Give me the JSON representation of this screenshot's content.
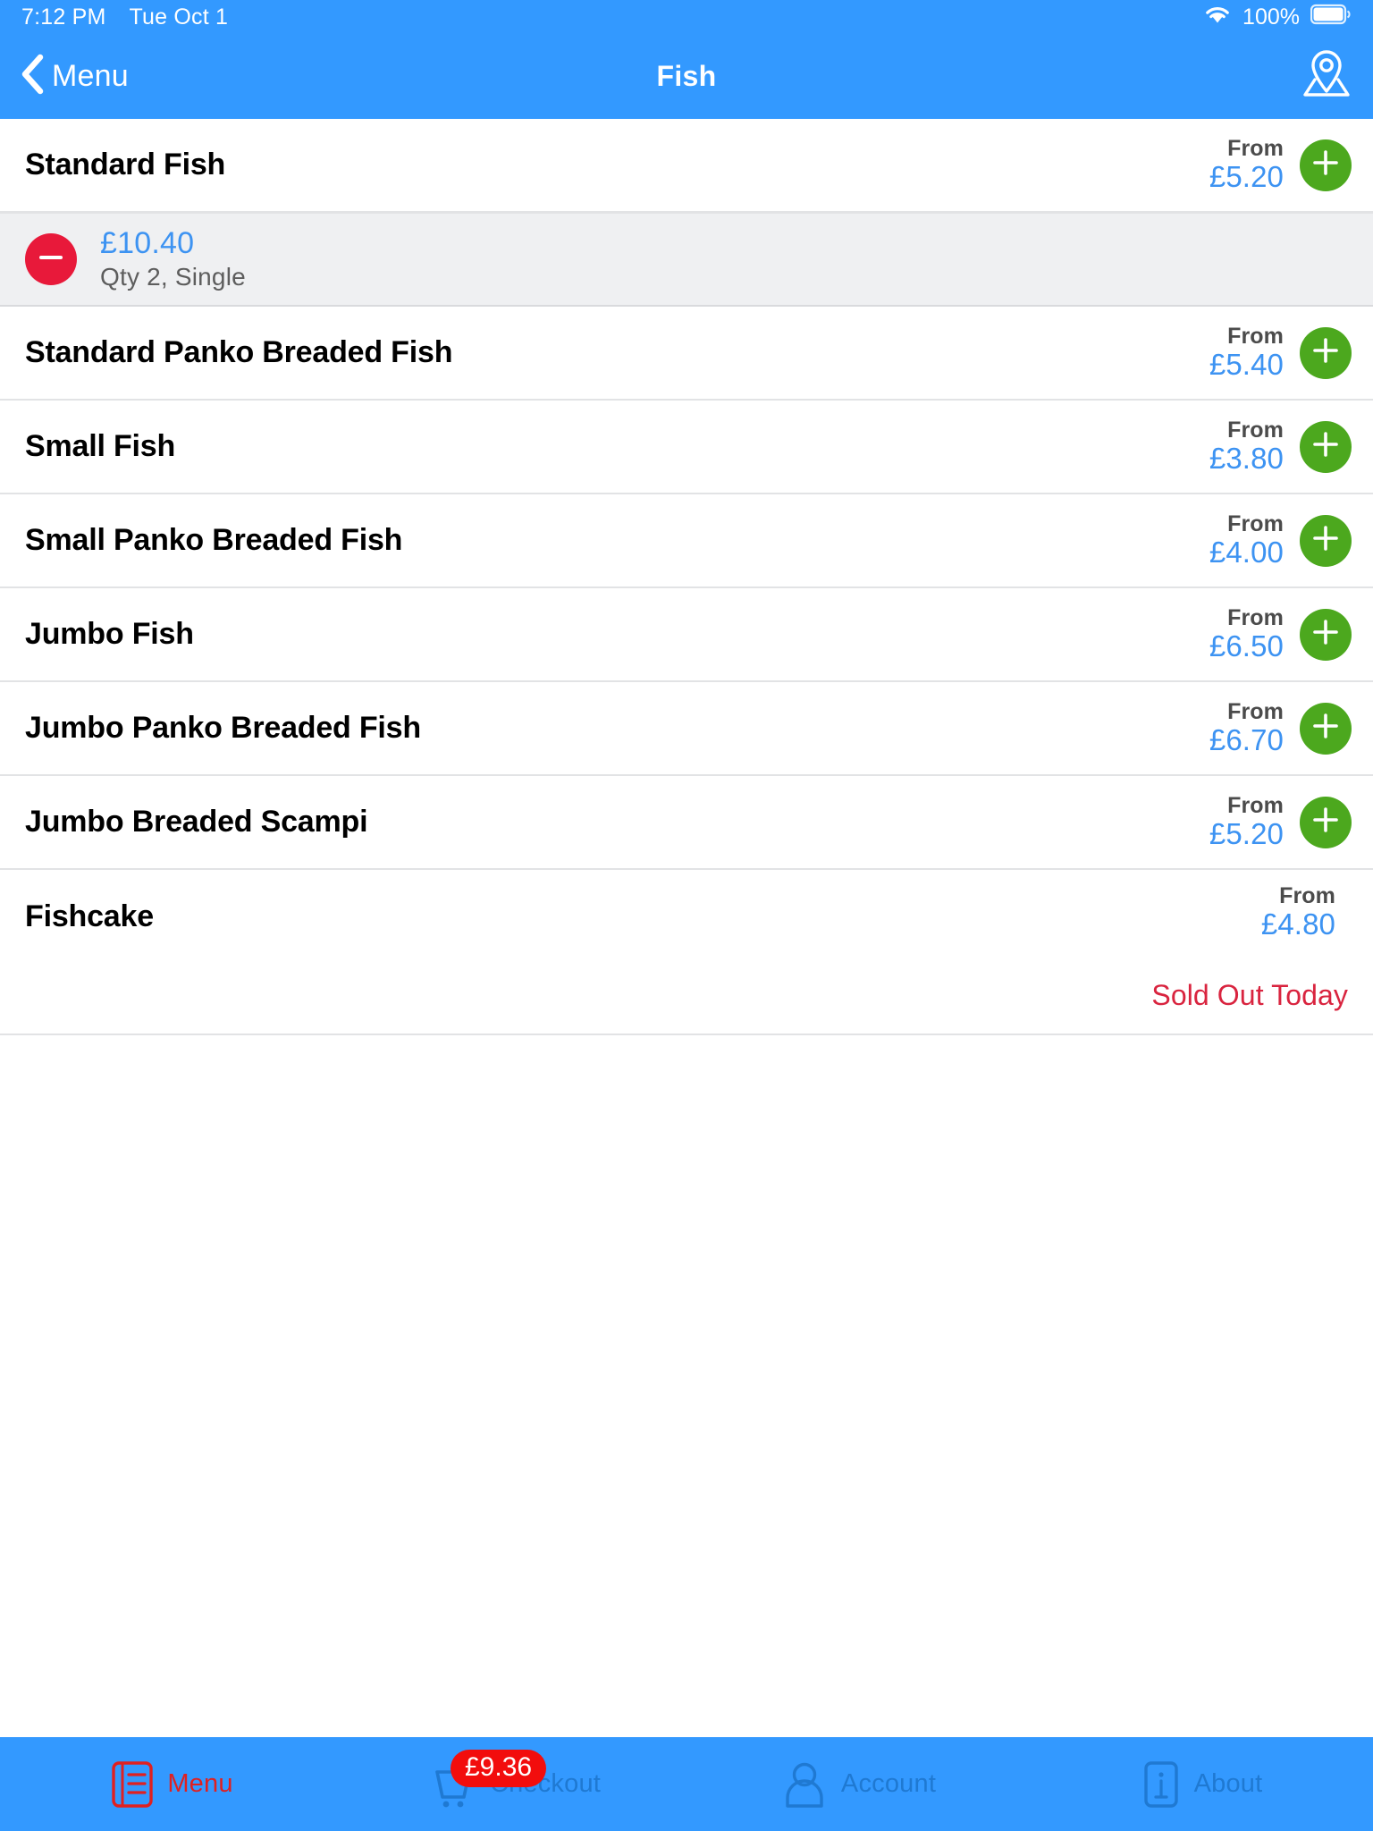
{
  "status_bar": {
    "time": "7:12 PM",
    "date": "Tue Oct 1",
    "battery_percent": "100%",
    "wifi_icon": "wifi-icon",
    "battery_icon": "battery-icon"
  },
  "nav_bar": {
    "back_label": "Menu",
    "back_icon": "chevron-left-icon",
    "title": "Fish",
    "right_icon": "map-pin-icon"
  },
  "colors": {
    "brand_blue": "#3399ff",
    "price_blue": "#3d93f2",
    "add_green": "#4ca81e",
    "remove_red": "#e8193a",
    "sold_out_red": "#d9243f",
    "badge_red": "#f20d0d",
    "cart_row_bg": "#eff0f2",
    "tab_inactive": "#1f79d2",
    "tab_active": "#e02020"
  },
  "list": {
    "from_label": "From",
    "items": [
      {
        "name": "Standard Fish",
        "from_label": "From",
        "price": "£5.20",
        "add_icon": "plus-icon",
        "sold_out": false,
        "cart_line": {
          "price": "£10.40",
          "detail": "Qty 2, Single",
          "remove_icon": "minus-icon"
        }
      },
      {
        "name": "Standard Panko Breaded Fish",
        "from_label": "From",
        "price": "£5.40",
        "add_icon": "plus-icon",
        "sold_out": false
      },
      {
        "name": "Small Fish",
        "from_label": "From",
        "price": "£3.80",
        "add_icon": "plus-icon",
        "sold_out": false
      },
      {
        "name": "Small Panko Breaded Fish",
        "from_label": "From",
        "price": "£4.00",
        "add_icon": "plus-icon",
        "sold_out": false
      },
      {
        "name": "Jumbo Fish",
        "from_label": "From",
        "price": "£6.50",
        "add_icon": "plus-icon",
        "sold_out": false
      },
      {
        "name": "Jumbo Panko Breaded Fish",
        "from_label": "From",
        "price": "£6.70",
        "add_icon": "plus-icon",
        "sold_out": false
      },
      {
        "name": "Jumbo Breaded Scampi",
        "from_label": "From",
        "price": "£5.20",
        "add_icon": "plus-icon",
        "sold_out": false
      },
      {
        "name": "Fishcake",
        "from_label": "From",
        "price": "£4.80",
        "sold_out": true,
        "sold_out_label": "Sold Out Today"
      }
    ]
  },
  "tab_bar": {
    "tabs": [
      {
        "label": "Menu",
        "icon": "menu-book-icon",
        "active": true
      },
      {
        "label": "Checkout",
        "icon": "shopping-cart-icon",
        "active": false,
        "badge": "£9.36"
      },
      {
        "label": "Account",
        "icon": "person-icon",
        "active": false
      },
      {
        "label": "About",
        "icon": "info-icon",
        "active": false
      }
    ]
  }
}
